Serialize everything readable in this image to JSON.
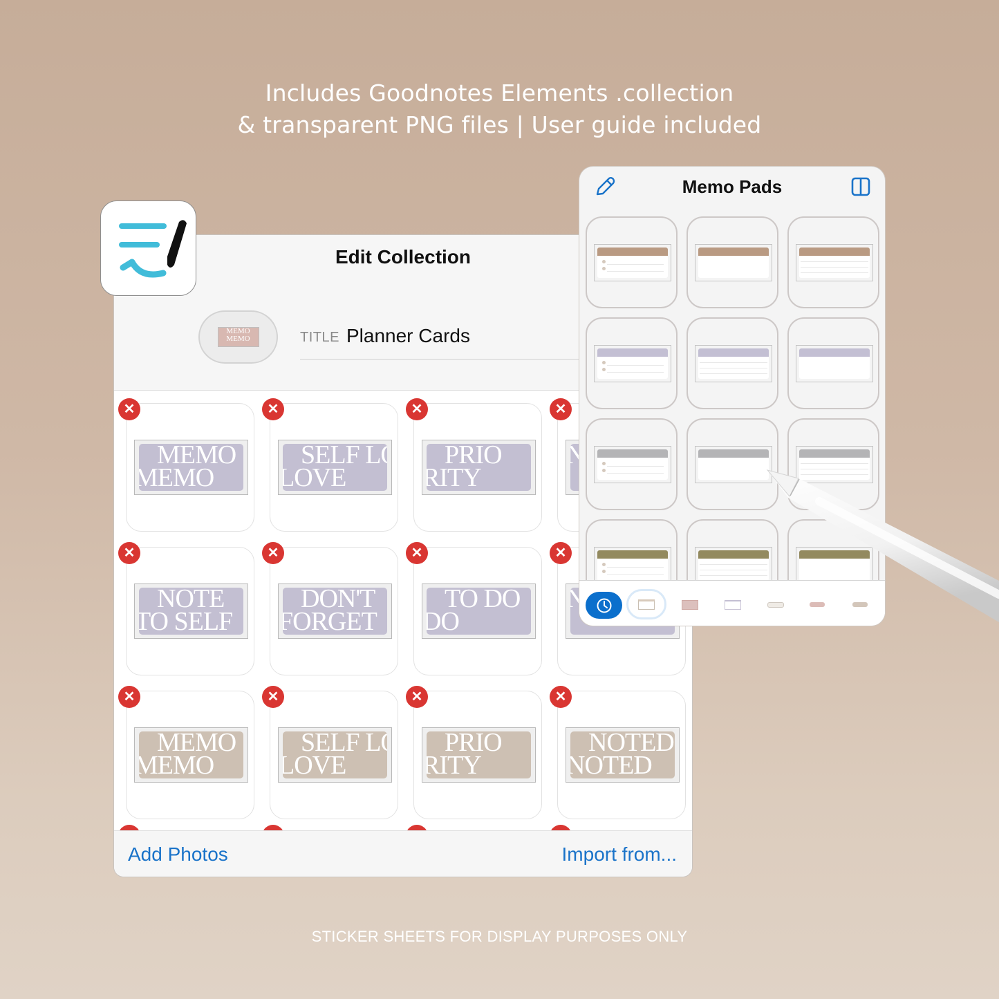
{
  "headline": {
    "line1": "Includes Goodnotes Elements .collection",
    "line2": "& transparent PNG files | User guide included"
  },
  "footer_note": "STICKER SHEETS FOR DISPLAY PURPOSES ONLY",
  "app_icon": {
    "name": "goodnotes-app-icon",
    "accent": "#41bcd9"
  },
  "edit_collection": {
    "title": "Edit Collection",
    "thumbnail_text": [
      "MEMO",
      "MEMO"
    ],
    "title_label": "TITLE",
    "title_value": "Planner Cards",
    "delete_glyph": "✕",
    "stickers": [
      {
        "line1": "MEMO",
        "line2": "MEMO",
        "color": "lavender"
      },
      {
        "line1": "SELF LO",
        "line2": "LOVE",
        "color": "lavender"
      },
      {
        "line1": "PRIO",
        "line2": "RITY",
        "color": "lavender"
      },
      {
        "line1": "",
        "line2": "N",
        "color": "lavender"
      },
      {
        "line1": "NOTE",
        "line2": "TO SELF",
        "color": "lavender"
      },
      {
        "line1": "DON'T",
        "line2": "FORGET",
        "color": "lavender"
      },
      {
        "line1": "TO DO",
        "line2": "DO",
        "color": "lavender"
      },
      {
        "line1": "",
        "line2": "NDER",
        "color": "lavender"
      },
      {
        "line1": "MEMO",
        "line2": "MEMO",
        "color": "tan"
      },
      {
        "line1": "SELF LO",
        "line2": "LOVE",
        "color": "tan"
      },
      {
        "line1": "PRIO",
        "line2": "RITY",
        "color": "tan"
      },
      {
        "line1": "NOTED",
        "line2": "NOTED",
        "color": "tan"
      }
    ],
    "add_photos": "Add Photos",
    "import_from": "Import from..."
  },
  "memo_pads": {
    "title": "Memo Pads",
    "edit_icon": "pencil-icon",
    "layout_icon": "split-view-icon",
    "pads": [
      {
        "color": "#b99a82",
        "style": "dots"
      },
      {
        "color": "#b99a82",
        "style": "blank"
      },
      {
        "color": "#b99a82",
        "style": "lines"
      },
      {
        "color": "#c3bfd3",
        "style": "dots"
      },
      {
        "color": "#c3bfd3",
        "style": "lines"
      },
      {
        "color": "#c3bfd3",
        "style": "blank"
      },
      {
        "color": "#b4b4b6",
        "style": "dots"
      },
      {
        "color": "#b4b4b6",
        "style": "blank"
      },
      {
        "color": "#b4b4b6",
        "style": "lines"
      },
      {
        "color": "#938a5f",
        "style": "dots"
      },
      {
        "color": "#938a5f",
        "style": "lines"
      },
      {
        "color": "#938a5f",
        "style": "blank"
      }
    ],
    "tabs": [
      {
        "name": "recents",
        "icon": "clock-icon",
        "active": true
      },
      {
        "name": "memo-pads",
        "selected": true
      },
      {
        "name": "sticker-sheet-pink"
      },
      {
        "name": "lavender-pad"
      },
      {
        "name": "label-cream"
      },
      {
        "name": "label-pink"
      },
      {
        "name": "label-tan"
      }
    ]
  },
  "colors": {
    "accent_blue": "#1a73c9",
    "delete_red": "#d93632",
    "lavender": "#c3bfd2",
    "tan": "#cdc0b3"
  }
}
